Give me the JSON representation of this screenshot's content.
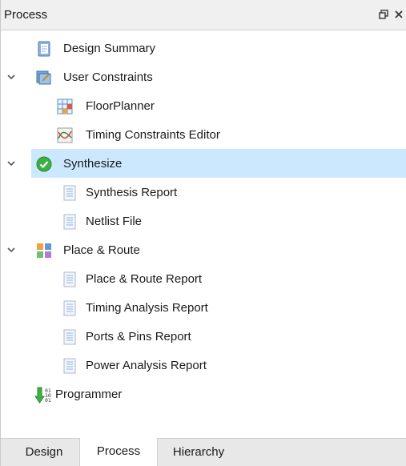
{
  "panel": {
    "title": "Process",
    "float_icon": "restore-icon",
    "close_icon": "close-icon"
  },
  "tree": {
    "items": [
      {
        "label": "Design Summary",
        "icon": "design-summary-icon"
      },
      {
        "label": "User Constraints",
        "icon": "user-constraints-icon",
        "expanded": true
      },
      {
        "label": "FloorPlanner",
        "icon": "floorplanner-icon"
      },
      {
        "label": "Timing Constraints Editor",
        "icon": "timing-editor-icon"
      },
      {
        "label": "Synthesize",
        "icon": "check-circle-icon",
        "expanded": true,
        "selected": true
      },
      {
        "label": "Synthesis Report",
        "icon": "report-icon"
      },
      {
        "label": "Netlist File",
        "icon": "report-icon"
      },
      {
        "label": "Place & Route",
        "icon": "place-route-icon",
        "expanded": true
      },
      {
        "label": "Place & Route Report",
        "icon": "report-icon"
      },
      {
        "label": "Timing Analysis Report",
        "icon": "report-icon"
      },
      {
        "label": "Ports & Pins Report",
        "icon": "report-icon"
      },
      {
        "label": "Power Analysis Report",
        "icon": "report-icon"
      },
      {
        "label": "Programmer",
        "icon": "programmer-icon"
      }
    ]
  },
  "tabs": [
    {
      "label": "Design",
      "active": false
    },
    {
      "label": "Process",
      "active": true
    },
    {
      "label": "Hierarchy",
      "active": false
    }
  ],
  "colors": {
    "selection": "#cce8ff",
    "check_green": "#3cb043",
    "tab_bar": "#e8e8e8"
  }
}
